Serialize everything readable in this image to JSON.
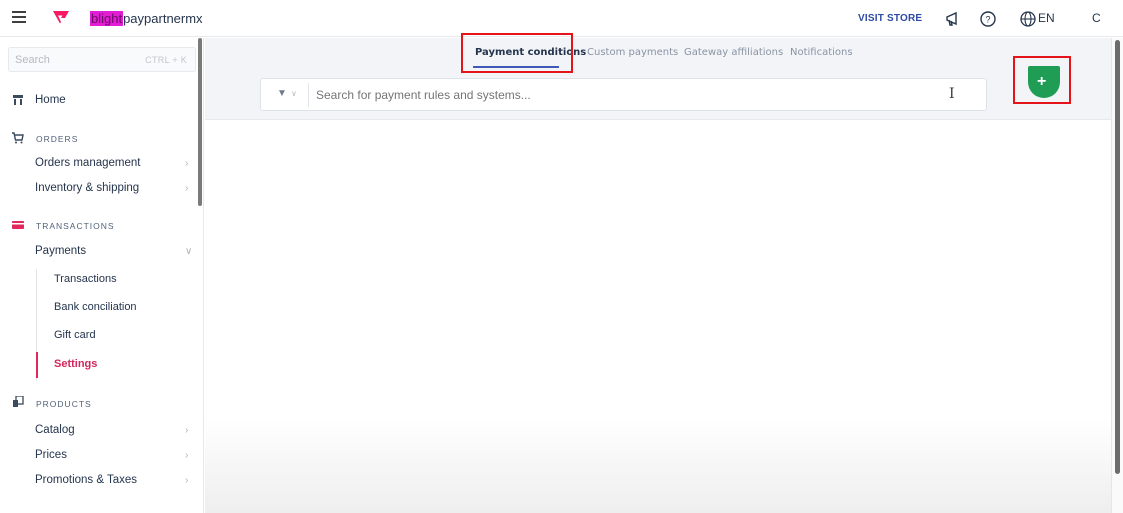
{
  "topbar": {
    "account_highlight": "blight",
    "account_name": "paypartnermx",
    "visit_store": "VISIT STORE",
    "language": "EN",
    "user_initial": "C"
  },
  "sidebar": {
    "search_placeholder": "Search",
    "search_shortcut": "CTRL + K",
    "home": "Home",
    "orders_section": "ORDERS",
    "orders_items": [
      "Orders management",
      "Inventory & shipping"
    ],
    "transactions_section": "TRANSACTIONS",
    "payments": "Payments",
    "payments_sub": [
      "Transactions",
      "Bank conciliation",
      "Gift card",
      "Settings"
    ],
    "products_section": "PRODUCTS",
    "products_items": [
      "Catalog",
      "Prices",
      "Promotions & Taxes"
    ]
  },
  "main": {
    "tabs": [
      "Payment conditions",
      "Custom payments",
      "Gateway affiliations",
      "Notifications"
    ],
    "search_placeholder": "Search for payment rules and systems...",
    "add_label": "+"
  },
  "colors": {
    "accent_pink": "#e0285d",
    "tab_underline": "#4158b6",
    "add_button": "#1f9d55",
    "highlight_box": "#e5131a"
  }
}
